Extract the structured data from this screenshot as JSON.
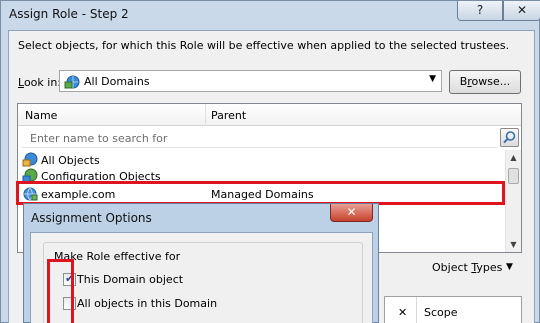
{
  "window": {
    "title": "Assign Role - Step 2",
    "help_glyph": "?",
    "close_glyph": "✕"
  },
  "description": "Select objects, for which this Role will be effective when applied to the selected trustees.",
  "look_in": {
    "label": "Look in:",
    "value": "All Domains",
    "browse_label": "Browse..."
  },
  "list": {
    "columns": [
      "Name",
      "Parent"
    ],
    "search_placeholder": "Enter name to search for",
    "rows": [
      {
        "name": "All Objects",
        "parent": "",
        "icon": "all-objects-icon"
      },
      {
        "name": "Configuration Objects",
        "parent": "",
        "icon": "configuration-objects-icon"
      },
      {
        "name": "example.com",
        "parent": "Managed Domains",
        "icon": "domain-icon",
        "selected": true
      }
    ]
  },
  "object_types_label": "Object Types",
  "lower_table": {
    "columns": [
      "✕",
      "Scope"
    ]
  },
  "popup": {
    "title": "Assignment Options",
    "close_glyph": "✕",
    "group_label": "Make Role effective for",
    "options": [
      {
        "label": "This Domain object",
        "checked": true
      },
      {
        "label": "All objects in this Domain",
        "checked": false
      }
    ]
  },
  "colors": {
    "highlight_red": "#e0141e",
    "title_bar": "#c9d9ea"
  }
}
